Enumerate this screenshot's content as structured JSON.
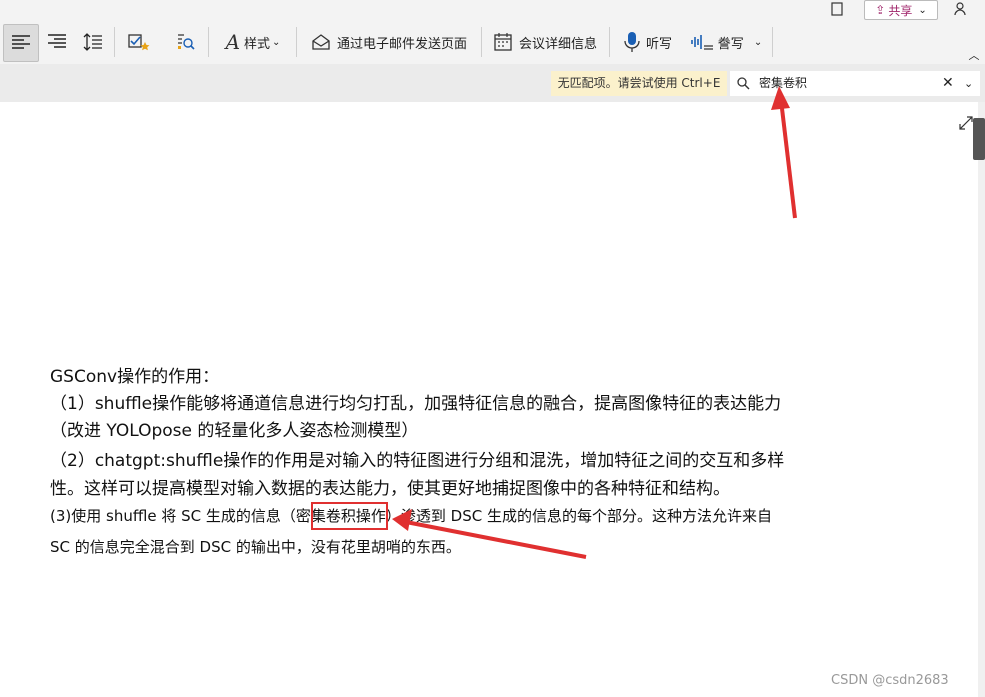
{
  "titlebar": {
    "share_label": "共享"
  },
  "toolbar": {
    "style_label": "样式",
    "email_label": "通过电子邮件发送页面",
    "meeting_label": "会议详细信息",
    "dictate_label": "听写",
    "transcribe_label": "誊写"
  },
  "search": {
    "message": "无匹配项。请尝试使用 Ctrl+E",
    "query": "密集卷积"
  },
  "document": {
    "lines": [
      "GSConv操作的作用：",
      "（1）shuffle操作能够将通道信息进行均匀打乱，加强特征信息的融合，提高图像特征的表达能力",
      "（改进 YOLOpose 的轻量化多人姿态检测模型）",
      "（2）chatgpt:shuffle操作的作用是对输入的特征图进行分组和混洗，增加特征之间的交互和多样",
      "性。这样可以提高模型对输入数据的表达能力，使其更好地捕捉图像中的各种特征和结构。",
      "(3)使用 shuffle 将 SC 生成的信息（密集卷积操作）渗透到 DSC 生成的信息的每个部分。这种方法允许来自",
      "SC 的信息完全混合到 DSC 的输出中，没有花里胡哨的东西。"
    ]
  },
  "watermark": "CSDN @csdn2683",
  "colors": {
    "annotation": "#e03030",
    "no_match_bg": "#fbf1cc"
  }
}
